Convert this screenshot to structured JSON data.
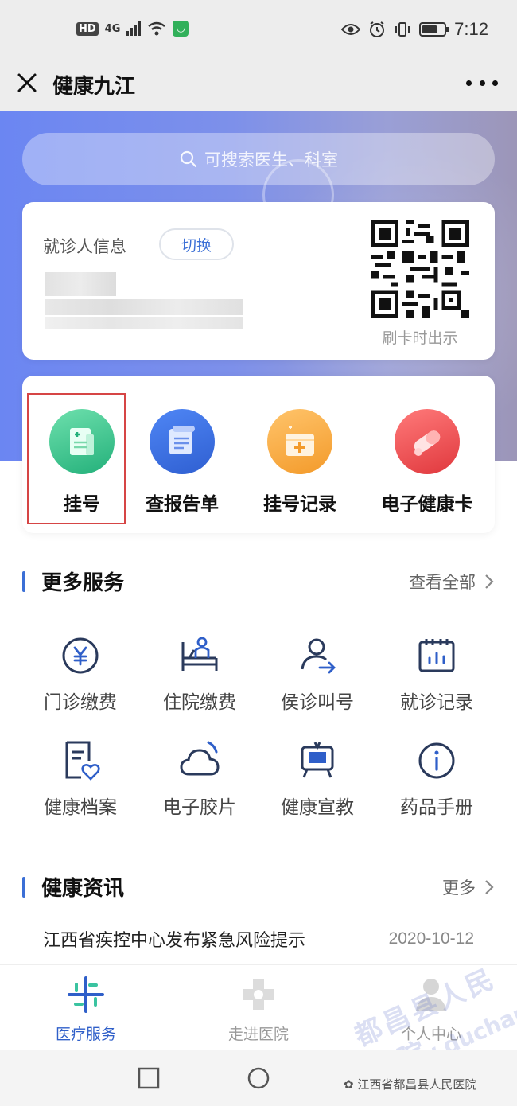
{
  "status_bar": {
    "hd": "HD",
    "network": "4G",
    "time": "7:12",
    "battery_level": 0.7
  },
  "title_bar": {
    "title": "健康九江",
    "close_icon": "close-icon",
    "more_icon": "more-dots-icon"
  },
  "search": {
    "placeholder": "可搜索医生、科室"
  },
  "patient_card": {
    "label": "就诊人信息",
    "switch_label": "切换",
    "qr_caption": "刷卡时出示"
  },
  "quick_services": [
    {
      "label": "挂号",
      "icon": "register-icon",
      "color": "#3cc48a"
    },
    {
      "label": "查报告单",
      "icon": "report-icon",
      "color": "#3f6ee0"
    },
    {
      "label": "挂号记录",
      "icon": "record-icon",
      "color": "#f5a23a"
    },
    {
      "label": "电子健康卡",
      "icon": "pill-icon",
      "color": "#ea4a4a"
    }
  ],
  "more_services": {
    "title": "更多服务",
    "link": "查看全部",
    "items": [
      {
        "label": "门诊缴费",
        "icon": "yuan-icon"
      },
      {
        "label": "住院缴费",
        "icon": "bed-icon"
      },
      {
        "label": "侯诊叫号",
        "icon": "queue-icon"
      },
      {
        "label": "就诊记录",
        "icon": "calendar-chart-icon"
      },
      {
        "label": "健康档案",
        "icon": "health-file-icon"
      },
      {
        "label": "电子胶片",
        "icon": "cloud-icon"
      },
      {
        "label": "健康宣教",
        "icon": "tv-icon"
      },
      {
        "label": "药品手册",
        "icon": "info-icon"
      }
    ]
  },
  "news": {
    "title": "健康资讯",
    "link": "更多",
    "items": [
      {
        "title": "江西省疾控中心发布紧急风险提示",
        "date": "2020-10-12"
      }
    ]
  },
  "tab_bar": [
    {
      "label": "医疗服务",
      "icon": "medical-service-icon",
      "active": true
    },
    {
      "label": "走进医院",
      "icon": "hospital-cross-icon",
      "active": false
    },
    {
      "label": "个人中心",
      "icon": "profile-icon",
      "active": false
    }
  ],
  "watermark": {
    "account": "江西省都昌县人民医院",
    "text": "都昌县人民医院",
    "url": "www.duchang"
  },
  "colors": {
    "accent": "#3b6fd6",
    "highlight_box": "#d64545"
  }
}
